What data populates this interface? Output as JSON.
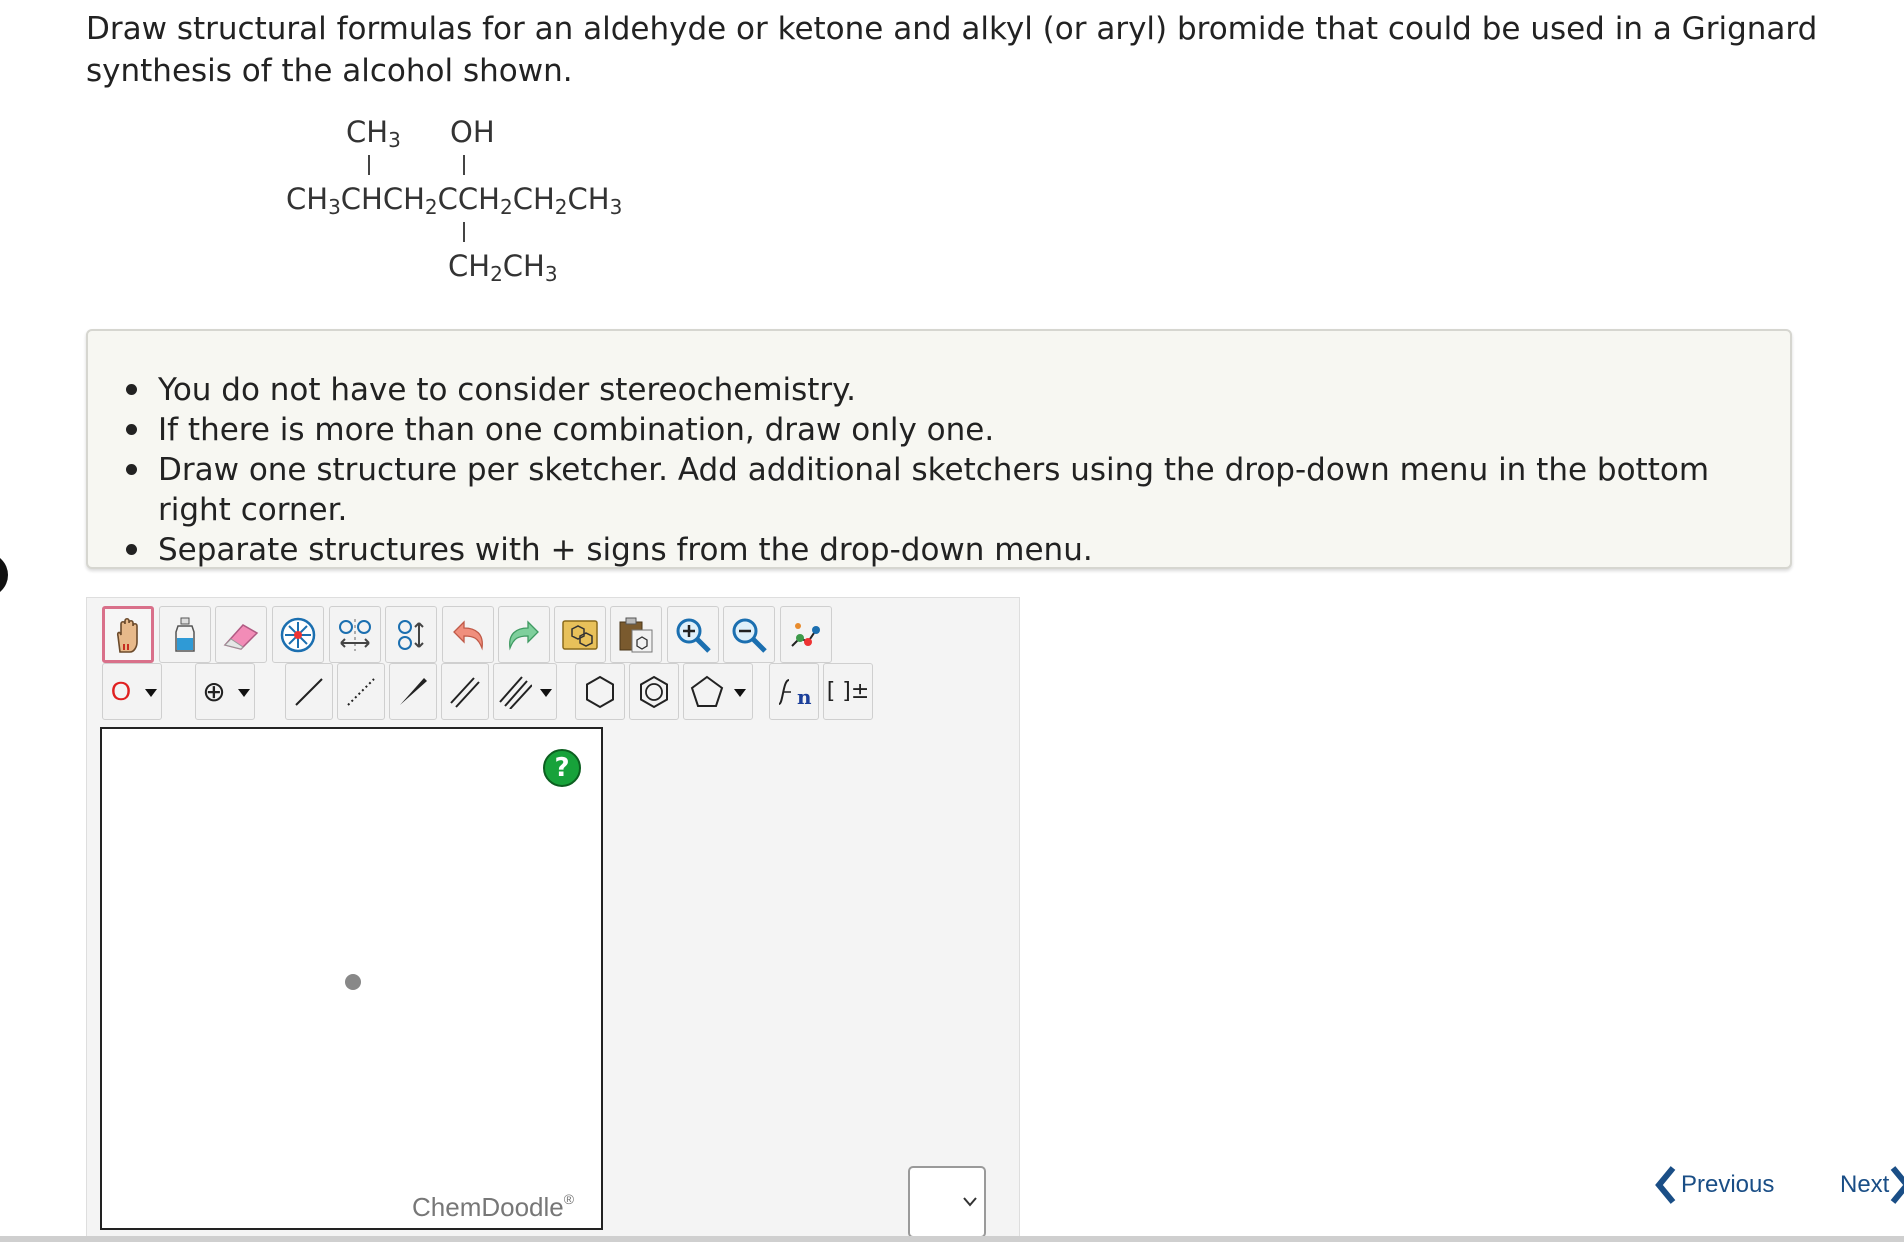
{
  "question": {
    "text": "Draw structural formulas for an aldehyde or ketone and alkyl (or aryl) bromide that could be used in a Grignard synthesis of the alcohol shown."
  },
  "structure": {
    "top_left": "CH",
    "top_left_sub": "3",
    "top_right": "OH",
    "main_a": "CH",
    "main_a_sub": "3",
    "main_b": "CHCH",
    "main_b_sub": "2",
    "main_c": "CCH",
    "main_c_sub": "2",
    "main_d": "CH",
    "main_d_sub": "2",
    "main_e": "CH",
    "main_e_sub": "3",
    "bottom_a": "CH",
    "bottom_a_sub": "2",
    "bottom_b": "CH",
    "bottom_b_sub": "3"
  },
  "notes": {
    "items": [
      "You do not have to consider stereochemistry.",
      "If there is more than one combination, draw only one.",
      "Draw one structure per sketcher. Add additional sketchers using the drop-down menu in the bottom right corner.",
      "Separate structures with + signs from the drop-down menu."
    ]
  },
  "toolbar": {
    "element_label": "O",
    "charge_label": "⊕",
    "brackets_label": "[ ]±"
  },
  "sketcher": {
    "help_label": "?",
    "brand": "ChemDoodle",
    "brand_mark": "®"
  },
  "navigation": {
    "previous_label": "Previous",
    "next_label": "Next"
  },
  "colors": {
    "link": "#1a4e86",
    "selected_border": "#d9708a",
    "help_green": "#17a23a"
  }
}
